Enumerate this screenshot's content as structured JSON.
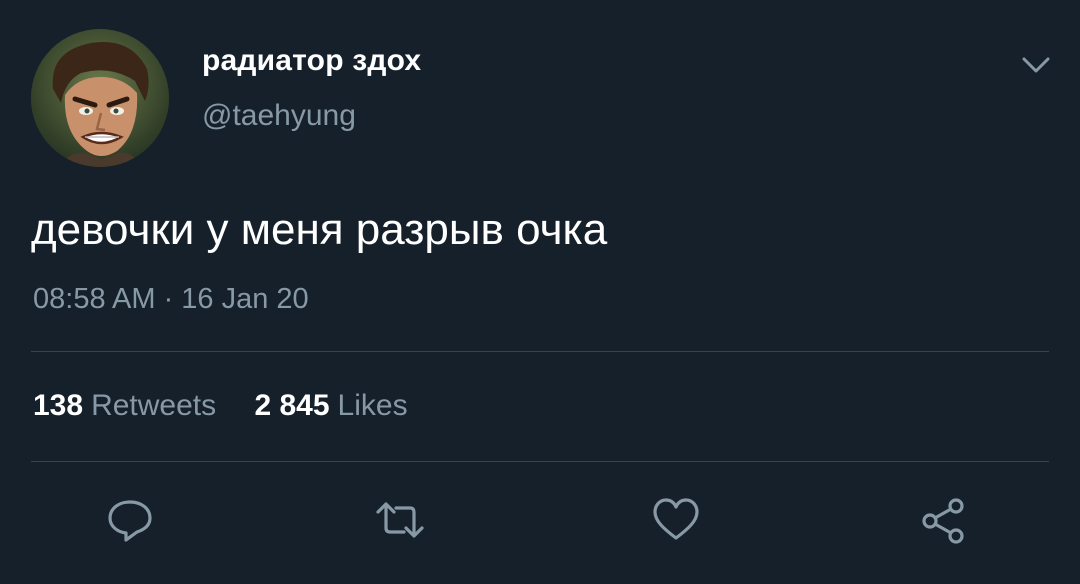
{
  "user": {
    "display_name": "радиатор здох",
    "handle": "@taehyung"
  },
  "tweet": {
    "text": "девочки у меня разрыв очка",
    "timestamp": "08:58 AM · 16 Jan 20"
  },
  "stats": {
    "retweets_count": "138",
    "retweets_label": "Retweets",
    "likes_count": "2 845",
    "likes_label": "Likes"
  },
  "icons": {
    "menu": "chevron-down-icon",
    "reply": "reply-icon",
    "retweet": "retweet-icon",
    "like": "heart-icon",
    "share": "share-icon"
  },
  "colors": {
    "background": "#15202b",
    "primary_text": "#ffffff",
    "secondary_text": "#8899a6",
    "divider": "#38444d"
  }
}
